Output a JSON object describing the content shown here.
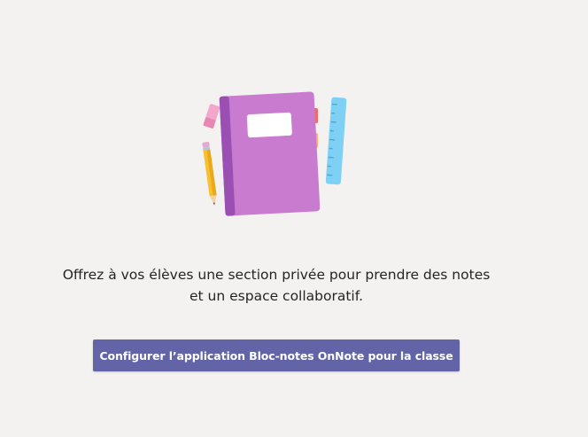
{
  "empty_state": {
    "message_line1": "Offrez à vos élèves une section privée pour prendre des notes",
    "message_line2": "et un espace collaboratif.",
    "illustration_icon": "notebook-with-pencil-and-ruler",
    "configure_button_label": "Configurer l’application Bloc-notes OnNote pour la classe"
  },
  "colors": {
    "background": "#f3f2f1",
    "button": "#6264a7",
    "notebook": "#c97ccf",
    "notebook_spine": "#9c4fb3",
    "ruler": "#7fd0f5",
    "pencil": "#f7c531",
    "eraser": "#f0a8cc"
  }
}
